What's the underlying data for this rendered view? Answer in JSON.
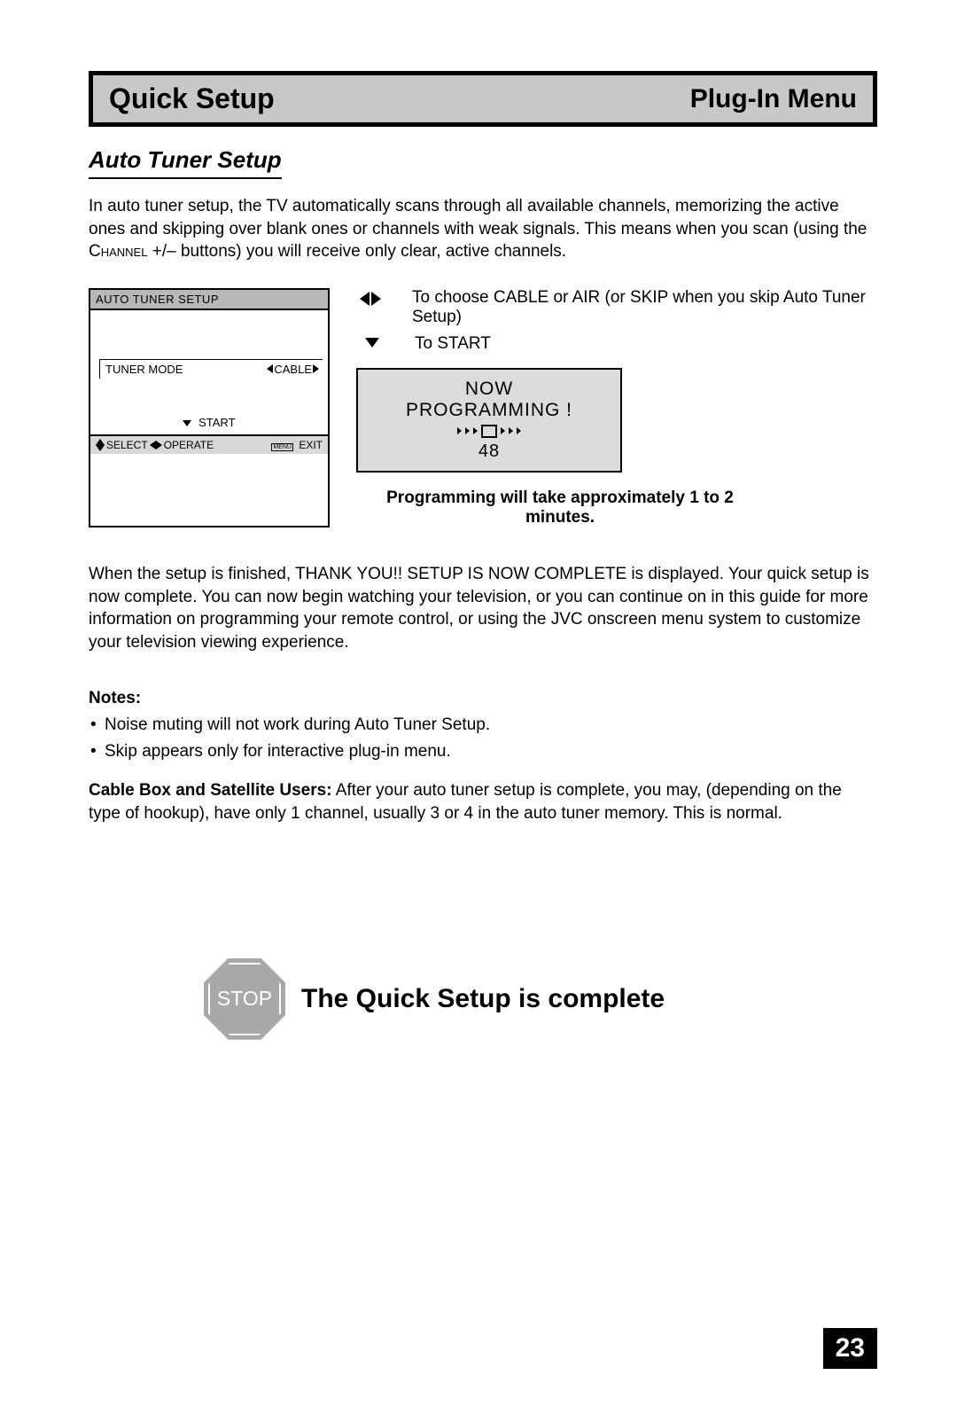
{
  "header": {
    "left": "Quick Setup",
    "right": "Plug-In Menu"
  },
  "section_title": "Auto Tuner Setup",
  "intro_1": "In auto tuner setup, the TV automatically scans through all available channels, memorizing the active ones and skipping over blank ones or channels with weak signals. This means when you scan (using the ",
  "intro_channel": "Channel",
  "intro_2": " +/– buttons) you will receive only clear, active channels.",
  "osd": {
    "title": "AUTO TUNER SETUP",
    "row_label": "TUNER MODE",
    "row_value": "CABLE",
    "start": "START",
    "footer_select": "SELECT",
    "footer_operate": "OPERATE",
    "footer_menu": "MENU",
    "footer_exit": "EXIT"
  },
  "instructions": {
    "lr": "To choose CABLE or AIR (or SKIP when you skip Auto Tuner Setup)",
    "down": "To START"
  },
  "programming": {
    "line1": "NOW",
    "line2": "PROGRAMMING !",
    "number": "48",
    "note": "Programming will take approximately 1 to 2 minutes."
  },
  "after_text": "When the setup is finished, THANK YOU!! SETUP IS NOW COMPLETE is displayed. Your quick setup is now complete. You can now begin watching your television, or you can continue on in this guide for more information on programming your remote control, or using the JVC onscreen menu system to customize your television viewing experience.",
  "notes_label": "Notes:",
  "notes": [
    "Noise muting will not work during Auto Tuner Setup.",
    "Skip appears only for interactive plug-in menu."
  ],
  "cable_note_label": "Cable Box and Satellite Users:",
  "cable_note_text": "  After your auto tuner setup is complete, you may, (depending on the type of hookup), have only 1 channel, usually 3 or 4 in the auto tuner memory.  This is normal.",
  "stop": {
    "sign": "STOP",
    "text": "The Quick Setup is complete"
  },
  "page_number": "23"
}
